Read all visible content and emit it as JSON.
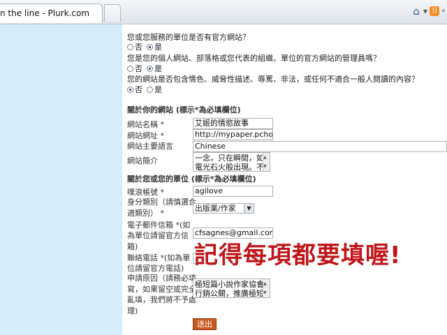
{
  "browser": {
    "tab_title": "n the line - Plurk.com",
    "home_icon": "home-icon",
    "feed_icon": "feed-icon"
  },
  "form": {
    "q1": {
      "text": "您或您服務的單位是否有官方網站？",
      "opt_no": "否",
      "opt_yes": "是",
      "selected": "yes"
    },
    "q2": {
      "text": "您是您的個人網站、部落格或您代表的組織、單位的官方網站的管理員嗎？",
      "opt_no": "否",
      "opt_yes": "是",
      "selected": "yes"
    },
    "q3": {
      "text": "您的網站是否包含情色、威脅性描述、辱罵、非法，或任何不適合一般人閱讀的內容？",
      "opt_no": "否",
      "opt_yes": "是",
      "selected": "no"
    },
    "site_section": "關於你的網站 (標示*為必填欄位)",
    "site_name_label": "網站名稱 *",
    "site_name_value": "艾姬的情慾故事",
    "site_url_label": "網站網址 *",
    "site_url_value": "http://mypaper.pchome",
    "site_lang_label": "網站主要語言",
    "site_lang_value": "Chinese",
    "site_desc_label": "網站簡介",
    "site_desc_value": "一念，只在瞬間，如電光石火般出現。不",
    "unit_section": "關於您或您的單位 (標示*為必填欄位)",
    "plurk_label": "噗浪帳號 *",
    "plurk_value": "agilove",
    "identity_label_1": "身分類別（請慎選合",
    "identity_label_2": "適類別） *",
    "identity_value": "出版業/作家",
    "email_label_1": "電子郵件信箱 *(如",
    "email_label_2": "為單位請留官方信",
    "email_label_3": "箱)",
    "email_value": "cfsagnes@gmail.com",
    "phone_label_1": "聯絡電話 *(如為單",
    "phone_label_2": "位請留官方電話)",
    "reason_label_1": "申請原因（請務必填",
    "reason_label_2": "寫，如果留空或完全",
    "reason_label_3": "亂填，我們將不予處",
    "reason_label_4": "理)",
    "reason_value": "極短篇小說作家協會行銷公關，推廣極短",
    "submit_label": "送出"
  },
  "annotation": "記得每項都要填喔!",
  "colors": {
    "sidebar": "#d6ecfa",
    "submit": "#c85a1f",
    "annotation": "#c0161a"
  }
}
